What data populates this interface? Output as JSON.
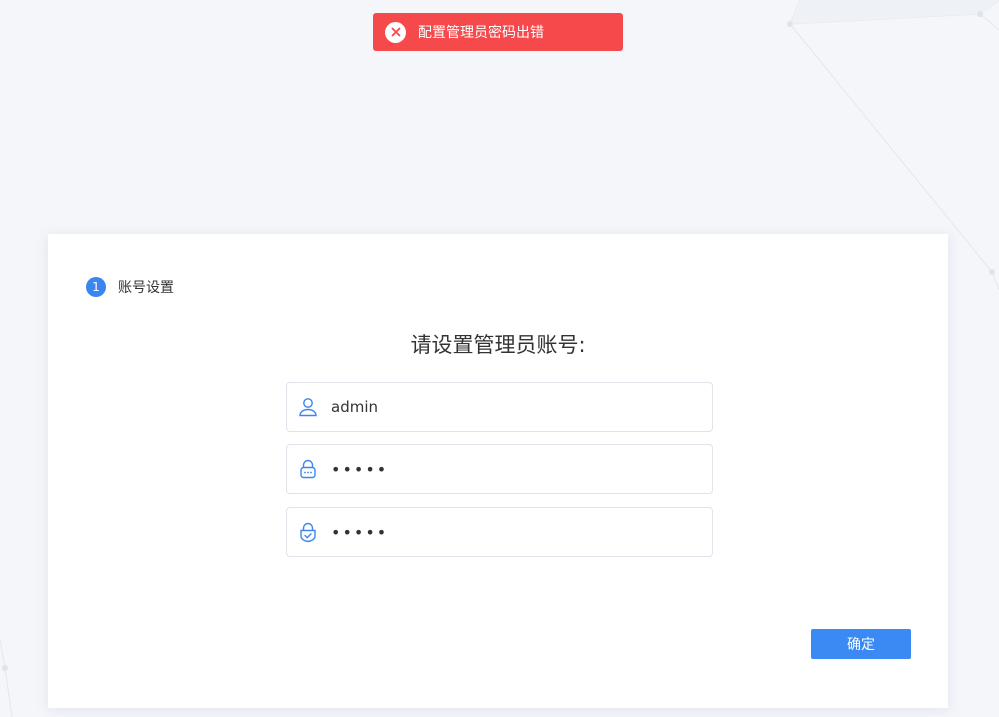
{
  "toast": {
    "message": "配置管理员密码出错",
    "type": "error",
    "color": "#f5494b"
  },
  "step": {
    "number": "1",
    "label": "账号设置"
  },
  "form": {
    "title": "请设置管理员账号:",
    "username": {
      "value": "admin",
      "icon": "user-icon"
    },
    "password": {
      "value": "12345",
      "icon": "lock-icon"
    },
    "confirm_password": {
      "value": "12345",
      "icon": "lock-check-icon"
    },
    "submit_label": "确定"
  },
  "colors": {
    "accent": "#3b8af3",
    "error": "#f5494b",
    "background": "#f4f6fa"
  }
}
